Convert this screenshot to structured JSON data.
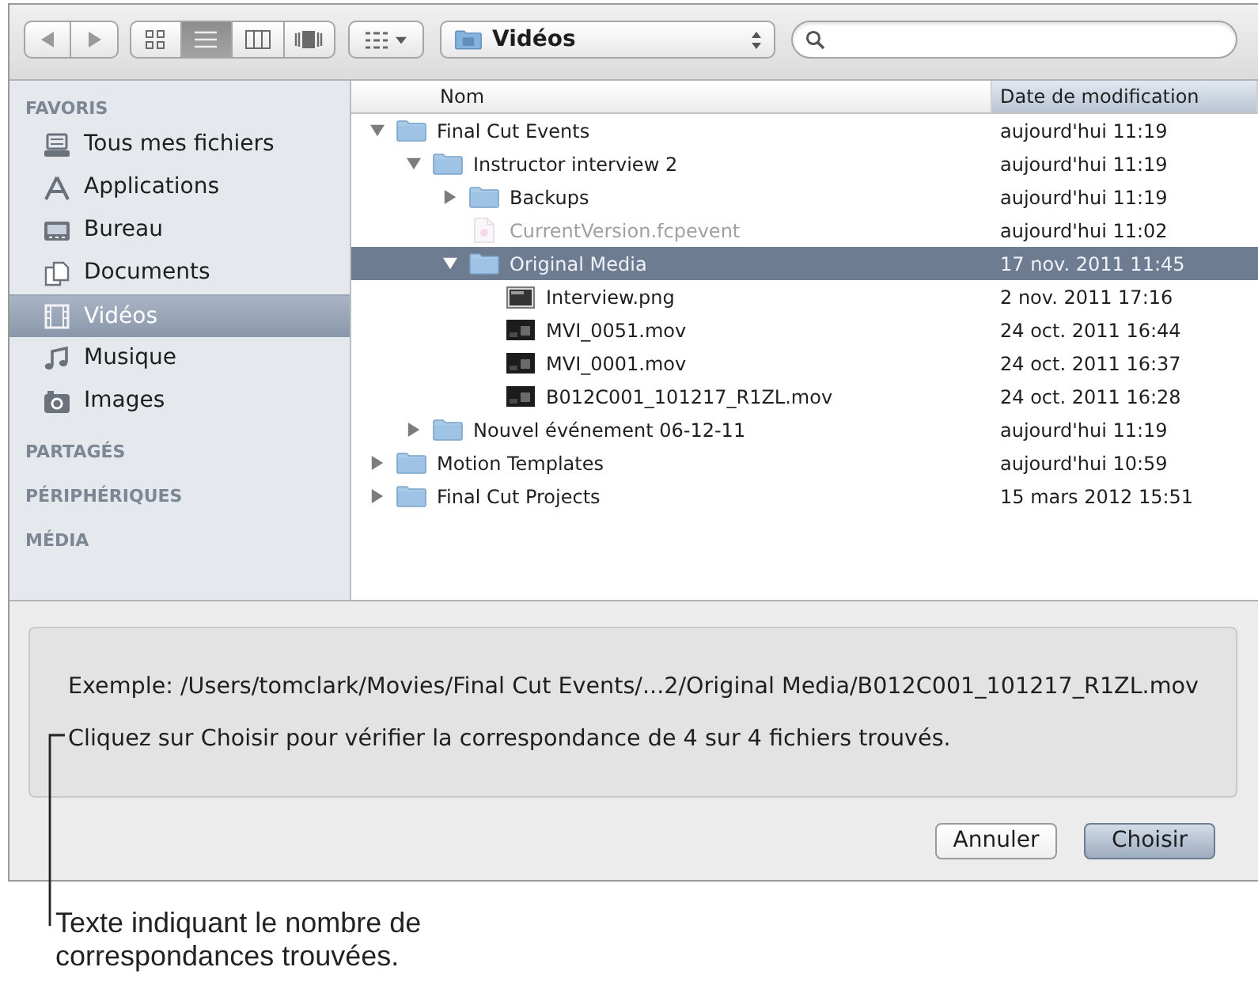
{
  "toolbar": {
    "view_buttons": [
      {
        "selected": false
      },
      {
        "selected": true
      },
      {
        "selected": false
      },
      {
        "selected": false
      }
    ],
    "location": "Vidéos"
  },
  "sidebar": {
    "sections": [
      {
        "heading": "FAVORIS",
        "items": [
          {
            "label": "Tous mes fichiers",
            "selected": false
          },
          {
            "label": "Applications",
            "selected": false
          },
          {
            "label": "Bureau",
            "selected": false
          },
          {
            "label": "Documents",
            "selected": false
          },
          {
            "label": "Vidéos",
            "selected": true
          },
          {
            "label": "Musique",
            "selected": false
          },
          {
            "label": "Images",
            "selected": false
          }
        ]
      },
      {
        "heading": "PARTAGÉS"
      },
      {
        "heading": "PÉRIPHÉRIQUES"
      },
      {
        "heading": "MÉDIA"
      }
    ]
  },
  "file_list": {
    "columns": [
      {
        "label": "Nom",
        "sorted": false
      },
      {
        "label": "Date de modification",
        "sorted": true
      }
    ],
    "rows": [
      {
        "kind": "folder",
        "name": "Final Cut Events",
        "modified": "aujourd'hui 11:19",
        "expanded": true,
        "selected": false,
        "disabled": false,
        "children": [
          {
            "kind": "folder",
            "name": "Instructor interview 2",
            "modified": "aujourd'hui 11:19",
            "expanded": true,
            "selected": false,
            "disabled": false,
            "children": [
              {
                "kind": "folder",
                "name": "Backups",
                "modified": "aujourd'hui 11:19",
                "expanded": false,
                "selected": false,
                "disabled": false
              },
              {
                "kind": "document",
                "name": "CurrentVersion.fcpevent",
                "modified": "aujourd'hui 11:02",
                "selected": false,
                "disabled": true
              },
              {
                "kind": "folder",
                "name": "Original Media",
                "modified": "17 nov. 2011 11:45",
                "expanded": true,
                "selected": true,
                "disabled": false,
                "children": [
                  {
                    "kind": "image",
                    "name": "Interview.png",
                    "modified": "2 nov. 2011 17:16",
                    "selected": false,
                    "disabled": false
                  },
                  {
                    "kind": "video",
                    "name": "MVI_0051.mov",
                    "modified": "24 oct. 2011 16:44",
                    "selected": false,
                    "disabled": false
                  },
                  {
                    "kind": "video",
                    "name": "MVI_0001.mov",
                    "modified": "24 oct. 2011 16:37",
                    "selected": false,
                    "disabled": false
                  },
                  {
                    "kind": "video",
                    "name": "B012C001_101217_R1ZL.mov",
                    "modified": "24 oct. 2011 16:28",
                    "selected": false,
                    "disabled": false
                  }
                ]
              }
            ]
          },
          {
            "kind": "folder",
            "name": "Nouvel événement 06-12-11",
            "modified": "aujourd'hui 11:19",
            "expanded": false,
            "selected": false,
            "disabled": false
          }
        ]
      },
      {
        "kind": "folder",
        "name": "Motion Templates",
        "modified": "aujourd'hui 10:59",
        "expanded": false,
        "selected": false,
        "disabled": false
      },
      {
        "kind": "folder",
        "name": "Final Cut Projects",
        "modified": "15 mars 2012 15:51",
        "expanded": false,
        "selected": false,
        "disabled": false
      }
    ]
  },
  "panel": {
    "example": "Exemple: /Users/tomclark/Movies/Final Cut Events/...2/Original Media/B012C001_101217_R1ZL.mov",
    "message": "Cliquez sur Choisir pour vérifier la correspondance de 4 sur 4 fichiers trouvés."
  },
  "buttons": [
    {
      "label": "Annuler",
      "default": false
    },
    {
      "label": "Choisir",
      "default": true
    }
  ],
  "annotation": {
    "text": "Texte indiquant le nombre de correspondances trouvées."
  }
}
